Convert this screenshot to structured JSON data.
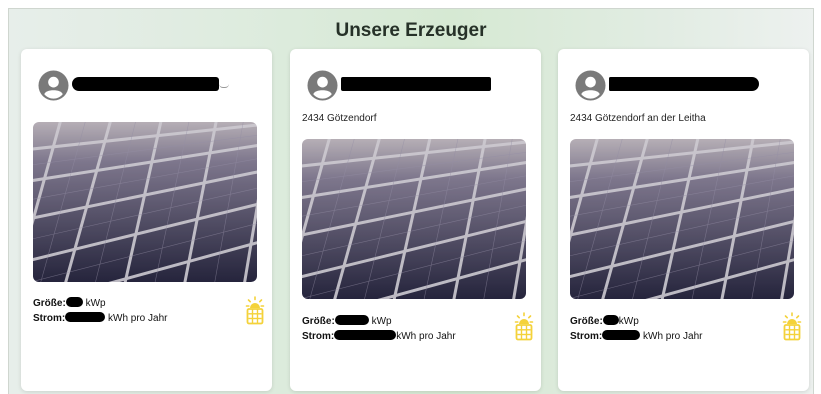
{
  "section": {
    "title": "Unsere Erzeuger"
  },
  "producers": [
    {
      "location": "",
      "size_label": "Größe:",
      "size_unit": "kWp",
      "power_label": "Strom:",
      "power_unit": "kWh pro Jahr",
      "icon": "solar-panel-sun-icon"
    },
    {
      "location": "2434 Götzendorf",
      "size_label": "Größe:",
      "size_unit": "kWp",
      "power_label": "Strom:",
      "power_unit": "kWh pro Jahr",
      "icon": "solar-panel-sun-icon"
    },
    {
      "location": "2434 Götzendorf an der Leitha",
      "size_label": "Größe:",
      "size_unit": "kWp",
      "power_label": "Strom:",
      "power_unit": "kWh pro Jahr",
      "icon": "solar-panel-sun-icon"
    }
  ],
  "colors": {
    "accent": "#f4d23a",
    "card": "#ffffff",
    "redaction": "#000000"
  }
}
